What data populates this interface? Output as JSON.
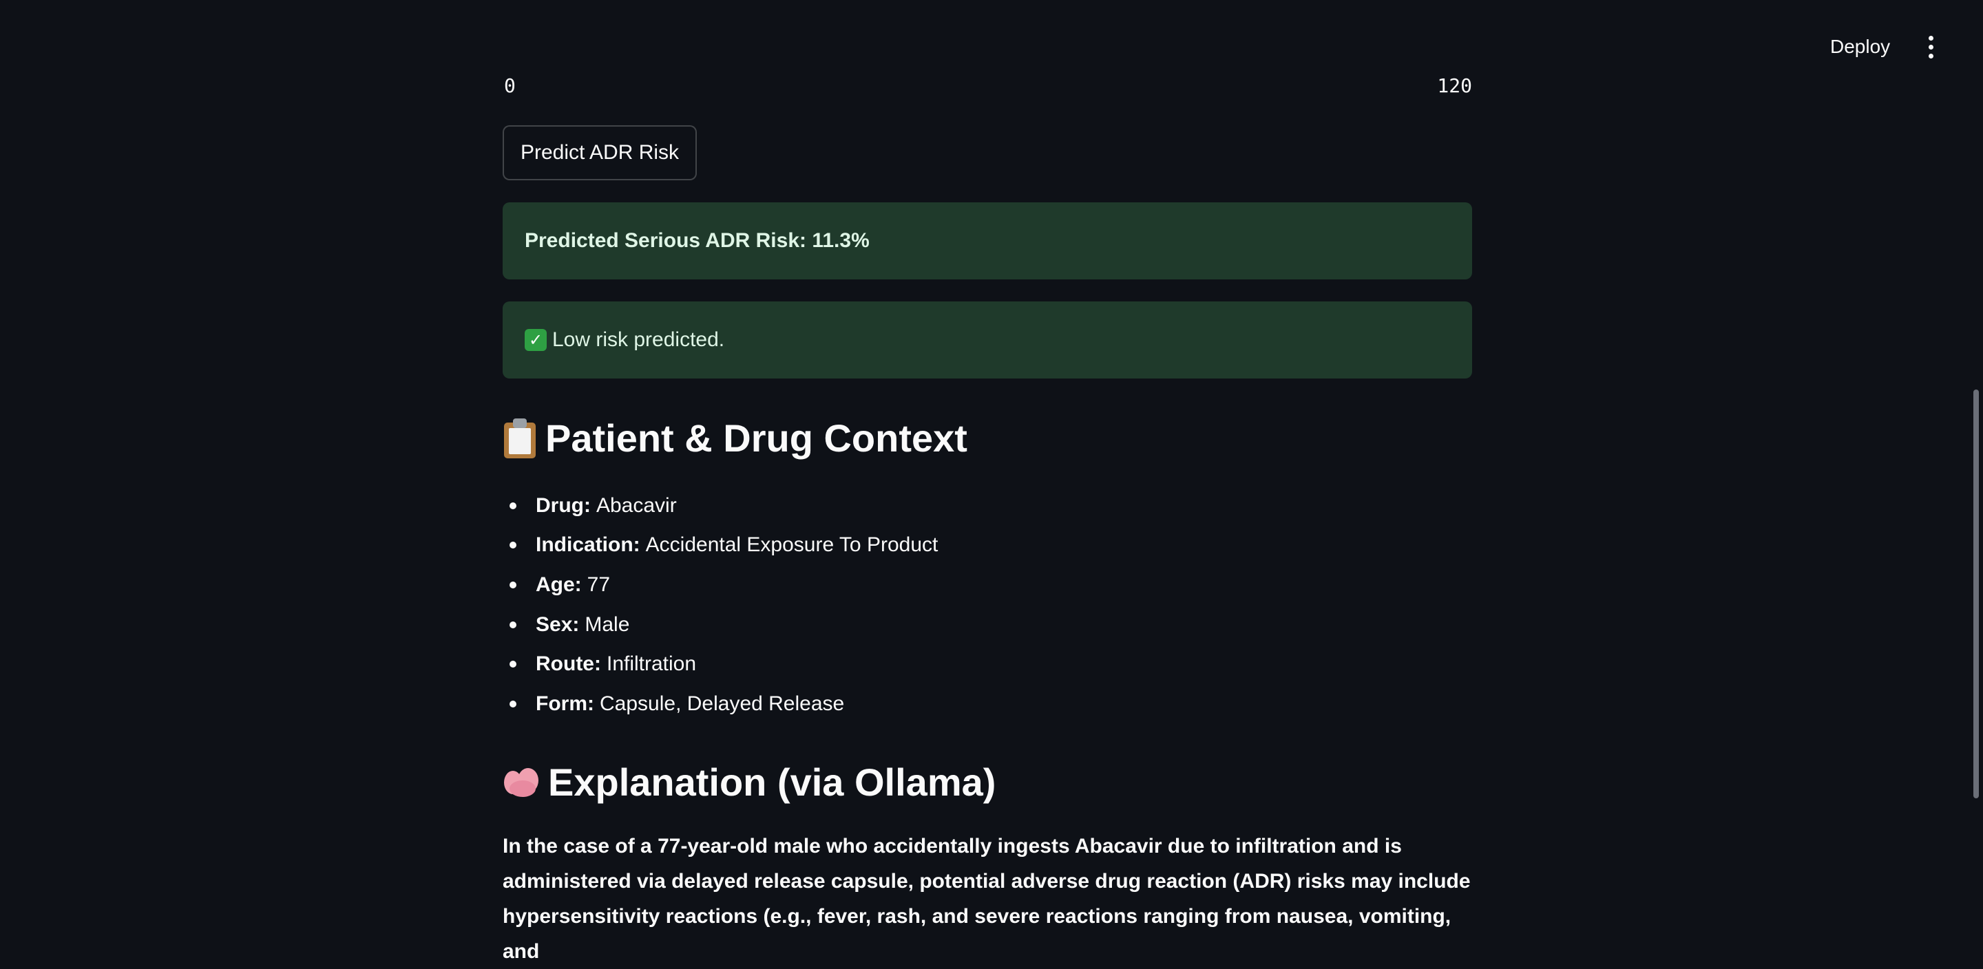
{
  "header": {
    "deploy_label": "Deploy",
    "menu_icon": "vertical-ellipsis-icon"
  },
  "slider": {
    "min_label": "0",
    "max_label": "120"
  },
  "predict_button": {
    "label": "Predict ADR Risk"
  },
  "alerts": {
    "risk_text": "Predicted Serious ADR Risk: 11.3%",
    "status_text": "Low risk predicted.",
    "status_icon": "check-mark-icon",
    "color_bg": "#1f3a2b"
  },
  "context": {
    "title": "Patient & Drug Context",
    "icon": "clipboard-icon",
    "items": [
      {
        "key": "Drug:",
        "value": "Abacavir"
      },
      {
        "key": "Indication:",
        "value": "Accidental Exposure To Product"
      },
      {
        "key": "Age:",
        "value": "77"
      },
      {
        "key": "Sex:",
        "value": "Male"
      },
      {
        "key": "Route:",
        "value": "Infiltration"
      },
      {
        "key": "Form:",
        "value": "Capsule, Delayed Release"
      }
    ]
  },
  "explanation": {
    "title": "Explanation (via Ollama)",
    "icon": "brain-icon",
    "lines": [
      "In the case of a 77-year-old male who accidentally ingests Abacavir due to infiltration and is",
      "administered via delayed release capsule, potential adverse drug reaction (ADR) risks may include",
      "hypersensitivity reactions (e.g., fever, rash, and severe reactions ranging from nausea, vomiting, and"
    ]
  },
  "theme": {
    "background": "#0e1117",
    "text": "#fafafa"
  }
}
